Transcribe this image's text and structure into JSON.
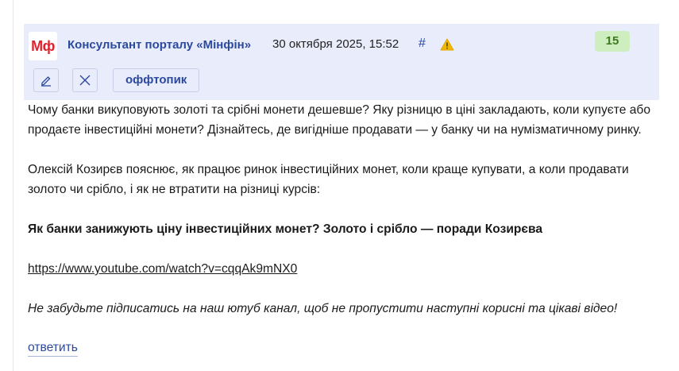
{
  "post": {
    "logo_text": "Мф",
    "author": "Консультант порталу «Мінфін»",
    "date": "30 октября 2025, 15:52",
    "hash": "#",
    "score": "15",
    "tag": "оффтопик",
    "colors": {
      "header_bg": "#e9ecfb",
      "author": "#2b4a9e",
      "logo": "#e3202b",
      "score_bg": "#cfeec0",
      "score_text": "#3d7a1f",
      "warning": "#f2b705"
    },
    "icons": [
      "edit-icon",
      "close-icon",
      "warning-icon"
    ]
  },
  "body": {
    "paragraph1": "Чому банки викуповують золоті та срібні монети дешевше? Яку різницю в ціні закладають, коли купуєте або продаєте інвестиційні монети? Дізнайтесь, де вигідніше продавати — у банку чи на нумізматичному ринку.",
    "paragraph2": "Олексій Козирєв пояснює, як працює ринок інвестиційних монет, коли краще купувати, а коли продавати золото чи срібло, і як не втратити на різниці курсів:",
    "headline": "Як банки занижують ціну інвестиційних монет? Золото і срібло — поради Козирєва",
    "video_url": "https://www.youtube.com/watch?v=cqqAk9mNX0",
    "closing": "Не забудьте підписатись на наш ютуб канал, щоб не пропустити наступні корисні та цікаві відео!"
  },
  "actions": {
    "reply": "ответить"
  }
}
